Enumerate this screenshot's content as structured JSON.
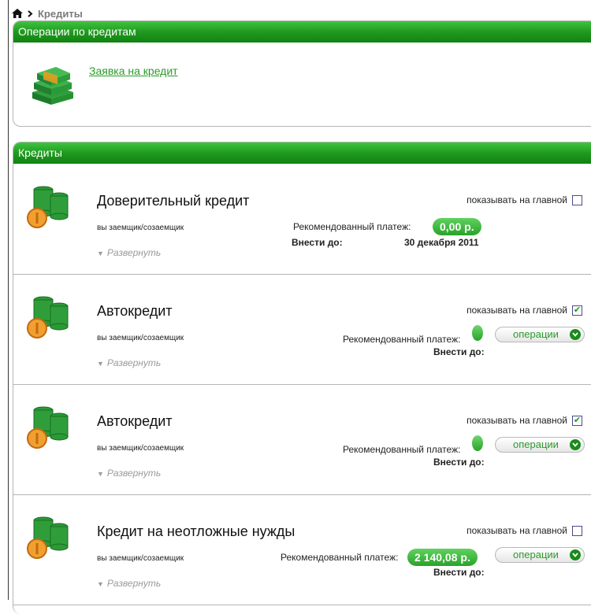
{
  "breadcrumb": {
    "current": "Кредиты"
  },
  "operations_panel": {
    "title": "Операции по кредитам",
    "link_label": "Заявка на кредит"
  },
  "credits_panel": {
    "title": "Кредиты",
    "items": [
      {
        "name": "Доверительный кредит",
        "role": "вы заемщик/созаемщик",
        "expand_label": "Развернуть",
        "show_main_label": "показывать на главной",
        "show_main_checked": false,
        "payment_label": "Рекомендованный платеж:",
        "payment_amount": "0,00 р.",
        "due_label": "Внести до:",
        "due_date": "30 декабря 2011",
        "has_operations": false
      },
      {
        "name": "Автокредит",
        "role": "вы заемщик/созаемщик",
        "expand_label": "Развернуть",
        "show_main_label": "показывать на главной",
        "show_main_checked": true,
        "payment_label": "Рекомендованный платеж:",
        "payment_amount": "",
        "due_label": "Внести до:",
        "due_date": "",
        "has_operations": true,
        "operations_label": "операции"
      },
      {
        "name": "Автокредит",
        "role": "вы заемщик/созаемщик",
        "expand_label": "Развернуть",
        "show_main_label": "показывать на главной",
        "show_main_checked": true,
        "payment_label": "Рекомендованный платеж:",
        "payment_amount": "",
        "due_label": "Внести до:",
        "due_date": "",
        "has_operations": true,
        "operations_label": "операции"
      },
      {
        "name": "Кредит на неотложные нужды",
        "role": "вы заемщик/созаемщик",
        "expand_label": "Развернуть",
        "show_main_label": "показывать на главной",
        "show_main_checked": false,
        "payment_label": "Рекомендованный платеж:",
        "payment_amount": "2 140,08 р.",
        "due_label": "Внести до:",
        "due_date": "",
        "has_operations": true,
        "operations_label": "операции"
      }
    ]
  },
  "colors": {
    "header_green": "#1f9a1f",
    "link_green": "#2b9a2b",
    "badge_green": "#2aa32a",
    "border_gray": "#b5b5b5"
  }
}
